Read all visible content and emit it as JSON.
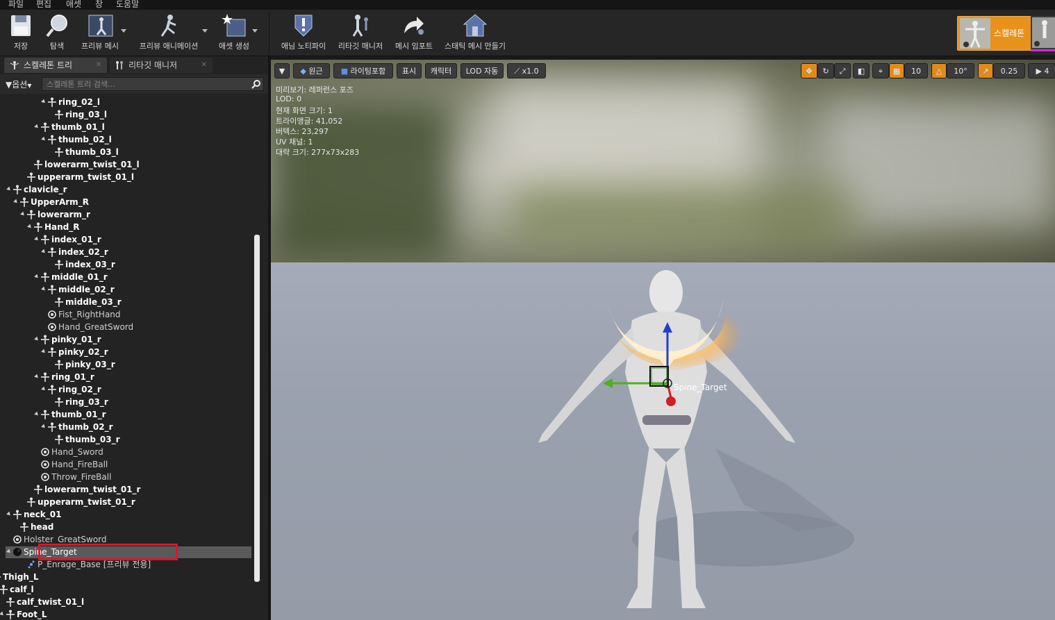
{
  "menu": [
    "파일",
    "편집",
    "애셋",
    "창",
    "도움말"
  ],
  "toolbar": {
    "buttons": [
      {
        "label": "저장",
        "icon": "save-icon"
      },
      {
        "label": "탐색",
        "icon": "browse-icon"
      },
      {
        "label": "프리뷰 메시",
        "icon": "preview-mesh-icon"
      },
      {
        "label": "프리뷰 애니메이션",
        "icon": "preview-animation-icon"
      },
      {
        "label": "애셋 생성",
        "icon": "create-asset-icon"
      },
      {
        "label": "애님 노티파이",
        "icon": "anim-notify-icon"
      },
      {
        "label": "리타깃 매니저",
        "icon": "retarget-manager-icon"
      },
      {
        "label": "메시 임포트",
        "icon": "import-mesh-icon"
      },
      {
        "label": "스태틱 메시 만들기",
        "icon": "make-static-mesh-icon"
      }
    ],
    "mode_skeleton": "스켈레톤"
  },
  "panel": {
    "tab1": "스켈레톤 트리",
    "tab2": "리타깃 매니저",
    "options": "옵션",
    "search_placeholder": "스켈레톤 트리 검색..."
  },
  "tree": [
    {
      "label": "ring_02_l",
      "type": "bone",
      "depth": 11,
      "tri": true
    },
    {
      "label": "ring_03_l",
      "type": "bone",
      "depth": 12,
      "tri": false
    },
    {
      "label": "thumb_01_l",
      "type": "bone",
      "depth": 10,
      "tri": true
    },
    {
      "label": "thumb_02_l",
      "type": "bone",
      "depth": 11,
      "tri": true
    },
    {
      "label": "thumb_03_l",
      "type": "bone",
      "depth": 12,
      "tri": false
    },
    {
      "label": "lowerarm_twist_01_l",
      "type": "bone",
      "depth": 9,
      "tri": false
    },
    {
      "label": "upperarm_twist_01_l",
      "type": "bone",
      "depth": 8,
      "tri": false
    },
    {
      "label": "clavicle_r",
      "type": "bone",
      "depth": 6,
      "tri": true
    },
    {
      "label": "UpperArm_R",
      "type": "bone",
      "depth": 7,
      "tri": true
    },
    {
      "label": "lowerarm_r",
      "type": "bone",
      "depth": 8,
      "tri": true
    },
    {
      "label": "Hand_R",
      "type": "bone",
      "depth": 9,
      "tri": true
    },
    {
      "label": "index_01_r",
      "type": "bone",
      "depth": 10,
      "tri": true
    },
    {
      "label": "index_02_r",
      "type": "bone",
      "depth": 11,
      "tri": true
    },
    {
      "label": "index_03_r",
      "type": "bone",
      "depth": 12,
      "tri": false
    },
    {
      "label": "middle_01_r",
      "type": "bone",
      "depth": 10,
      "tri": true
    },
    {
      "label": "middle_02_r",
      "type": "bone",
      "depth": 11,
      "tri": true
    },
    {
      "label": "middle_03_r",
      "type": "bone",
      "depth": 12,
      "tri": false
    },
    {
      "label": "Fist_RightHand",
      "type": "socket",
      "depth": 11,
      "tri": false
    },
    {
      "label": "Hand_GreatSword",
      "type": "socket",
      "depth": 11,
      "tri": false
    },
    {
      "label": "pinky_01_r",
      "type": "bone",
      "depth": 10,
      "tri": true
    },
    {
      "label": "pinky_02_r",
      "type": "bone",
      "depth": 11,
      "tri": true
    },
    {
      "label": "pinky_03_r",
      "type": "bone",
      "depth": 12,
      "tri": false
    },
    {
      "label": "ring_01_r",
      "type": "bone",
      "depth": 10,
      "tri": true
    },
    {
      "label": "ring_02_r",
      "type": "bone",
      "depth": 11,
      "tri": true
    },
    {
      "label": "ring_03_r",
      "type": "bone",
      "depth": 12,
      "tri": false
    },
    {
      "label": "thumb_01_r",
      "type": "bone",
      "depth": 10,
      "tri": true
    },
    {
      "label": "thumb_02_r",
      "type": "bone",
      "depth": 11,
      "tri": true
    },
    {
      "label": "thumb_03_r",
      "type": "bone",
      "depth": 12,
      "tri": false
    },
    {
      "label": "Hand_Sword",
      "type": "socket",
      "depth": 10,
      "tri": false
    },
    {
      "label": "Hand_FireBall",
      "type": "socket",
      "depth": 10,
      "tri": false
    },
    {
      "label": "Throw_FireBall",
      "type": "socket",
      "depth": 10,
      "tri": false
    },
    {
      "label": "lowerarm_twist_01_r",
      "type": "bone",
      "depth": 9,
      "tri": false
    },
    {
      "label": "upperarm_twist_01_r",
      "type": "bone",
      "depth": 8,
      "tri": false
    },
    {
      "label": "neck_01",
      "type": "bone",
      "depth": 6,
      "tri": true
    },
    {
      "label": "head",
      "type": "bone",
      "depth": 7,
      "tri": false
    },
    {
      "label": "Holster_GreatSword",
      "type": "socket",
      "depth": 6,
      "tri": false
    },
    {
      "label": "Spine_Target",
      "type": "selected",
      "depth": 6,
      "tri": true
    },
    {
      "label": "P_Enrage_Base [프리뷰 전용]",
      "type": "fx",
      "depth": 8,
      "tri": false
    },
    {
      "label": "Thigh_L",
      "type": "bone",
      "depth": 3,
      "tri": true
    },
    {
      "label": "calf_l",
      "type": "bone",
      "depth": 4,
      "tri": true
    },
    {
      "label": "calf_twist_01_l",
      "type": "bone",
      "depth": 5,
      "tri": false
    },
    {
      "label": "Foot_L",
      "type": "bone",
      "depth": 5,
      "tri": true
    }
  ],
  "viewport": {
    "perspective": "원근",
    "lighting": "라이팅포함",
    "show": "표시",
    "character": "캐릭터",
    "lod": "LOD 자동",
    "speed": "x1.0",
    "grid_snap": "10",
    "rot_snap": "10°",
    "scale_snap": "0.25",
    "cam_speed": "4",
    "info": [
      "미리보기: 레퍼런스 포즈",
      "LOD: 0",
      "현재 화면 크기: 1",
      "트라이앵글: 41,052",
      "버텍스: 23,297",
      "UV 채널: 1",
      "대략 크기: 277x73x283"
    ],
    "socket_label": "Spine_Target"
  },
  "colors": {
    "accent": "#e8921c",
    "selection_box": "#e0142a",
    "gizmo_x": "#d02020",
    "gizmo_y": "#50b020",
    "gizmo_z": "#2040d0"
  }
}
